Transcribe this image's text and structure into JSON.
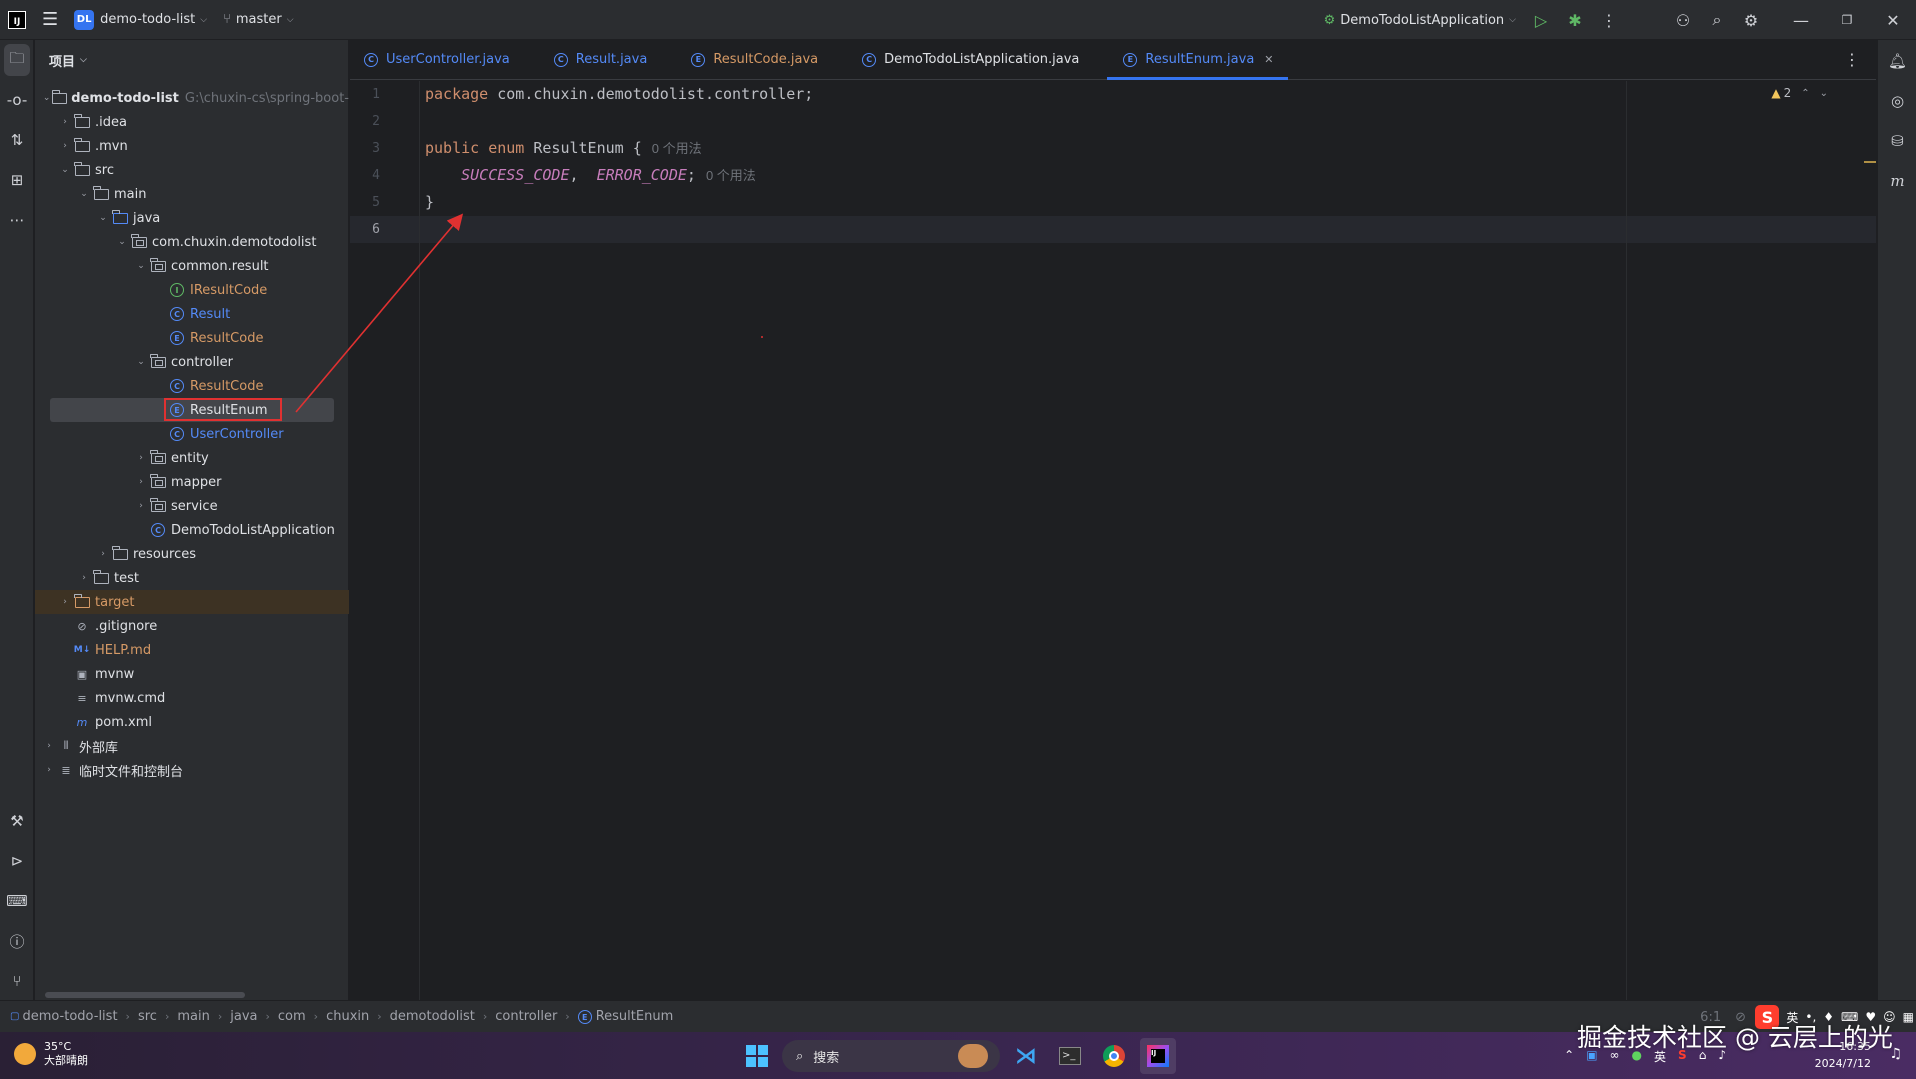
{
  "titlebar": {
    "logo": "IJ",
    "project_badge": "DL",
    "project_name": "demo-todo-list",
    "branch": "master",
    "run_config": "DemoTodoListApplication"
  },
  "project_panel": {
    "title": "项目",
    "root_name": "demo-todo-list",
    "root_path": "G:\\chuxin-cs\\spring-boot-",
    "items": [
      {
        "label": ".idea"
      },
      {
        "label": ".mvn"
      },
      {
        "label": "src"
      },
      {
        "label": "main"
      },
      {
        "label": "java"
      },
      {
        "label": "com.chuxin.demotodolist"
      },
      {
        "label": "common.result"
      },
      {
        "label": "IResultCode"
      },
      {
        "label": "Result"
      },
      {
        "label": "ResultCode"
      },
      {
        "label": "controller"
      },
      {
        "label": "ResultCode"
      },
      {
        "label": "ResultEnum"
      },
      {
        "label": "UserController"
      },
      {
        "label": "entity"
      },
      {
        "label": "mapper"
      },
      {
        "label": "service"
      },
      {
        "label": "DemoTodoListApplication"
      },
      {
        "label": "resources"
      },
      {
        "label": "test"
      },
      {
        "label": "target"
      },
      {
        "label": ".gitignore"
      },
      {
        "label": "HELP.md"
      },
      {
        "label": "mvnw"
      },
      {
        "label": "mvnw.cmd"
      },
      {
        "label": "pom.xml"
      },
      {
        "label": "外部库"
      },
      {
        "label": "临时文件和控制台"
      }
    ]
  },
  "tabs": [
    {
      "label": "UserController.java"
    },
    {
      "label": "Result.java"
    },
    {
      "label": "ResultCode.java"
    },
    {
      "label": "DemoTodoListApplication.java"
    },
    {
      "label": "ResultEnum.java"
    }
  ],
  "editor": {
    "line_numbers": [
      "1",
      "2",
      "3",
      "4",
      "5",
      "6"
    ],
    "line1_kw": "package",
    "line1_rest": " com.chuxin.demotodolist.controller;",
    "line3_kw1": "public",
    "line3_kw2": "enum",
    "line3_name": "ResultEnum",
    "line3_brace": " {",
    "line3_hint": "0 个用法",
    "line4_c1": "SUCCESS_CODE",
    "line4_sep": ",  ",
    "line4_c2": "ERROR_CODE",
    "line4_end": ";",
    "line4_hint": "0 个用法",
    "line5": "}",
    "warning_count": "2"
  },
  "statusbar": {
    "breadcrumbs": [
      "demo-todo-list",
      "src",
      "main",
      "java",
      "com",
      "chuxin",
      "demotodolist",
      "controller",
      "ResultEnum"
    ],
    "position": "6:1"
  },
  "taskbar": {
    "temperature": "35°C",
    "weather": "大部晴朗",
    "search_placeholder": "搜索",
    "time": "16:35",
    "date": "2024/7/12",
    "ime_lang": "英"
  },
  "watermark": "掘金技术社区 @ 云层上的光",
  "colors": {
    "accent": "#3574f0",
    "highlight_box": "#e03131",
    "arrow": "#e03131"
  }
}
